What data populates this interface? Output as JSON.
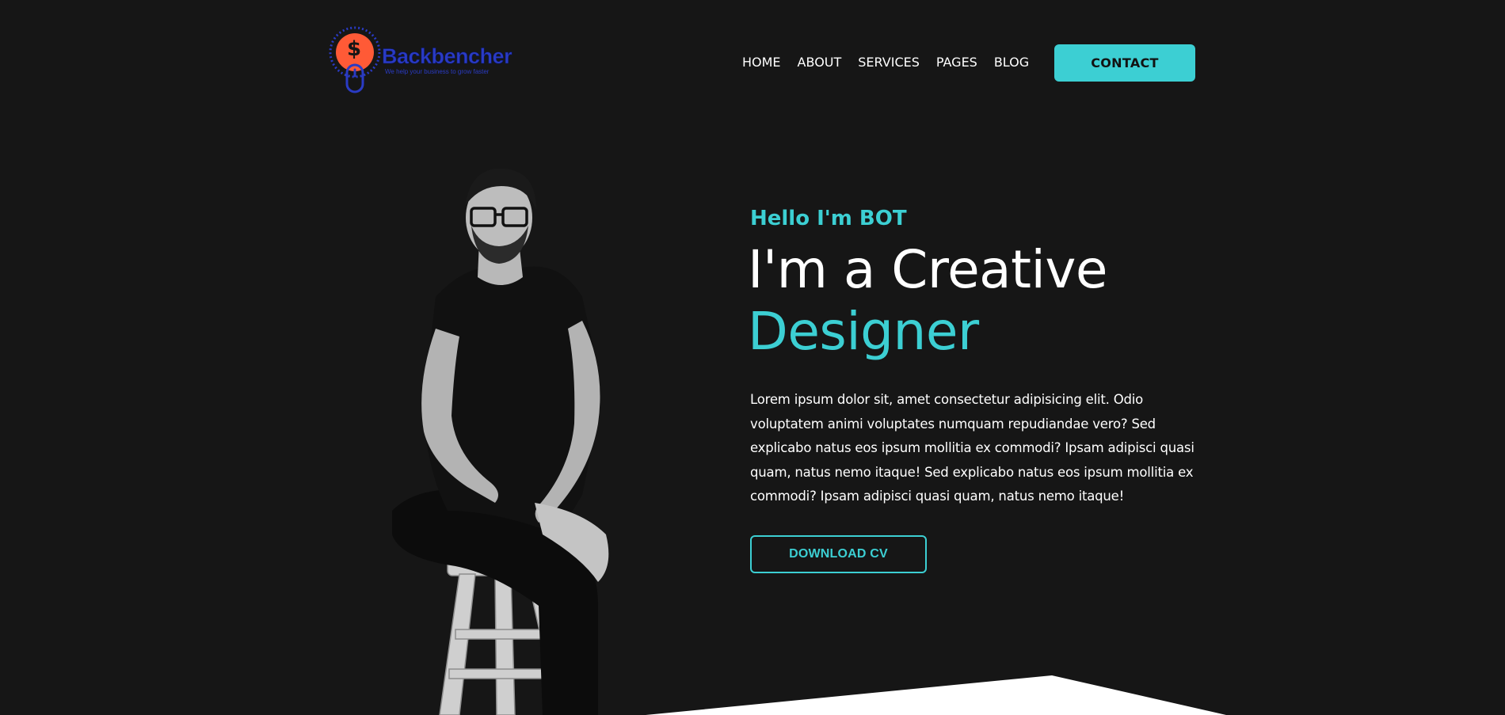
{
  "brand": {
    "name": "Backbencher",
    "tagline": "We help your business to grow faster",
    "dollar_symbol": "$",
    "colors": {
      "mark_orange": "#ff5a36",
      "mark_blue": "#2a3bc4"
    }
  },
  "nav": {
    "items": [
      {
        "label": "HOME"
      },
      {
        "label": "ABOUT"
      },
      {
        "label": "SERVICES"
      },
      {
        "label": "PAGES"
      },
      {
        "label": "BLOG"
      }
    ],
    "contact_label": "CONTACT"
  },
  "hero": {
    "greeting": "Hello I'm BOT",
    "headline_line1": "I'm a Creative",
    "headline_line2": "Designer",
    "description": "Lorem ipsum dolor sit, amet consectetur adipisicing elit. Odio voluptatem animi voluptates numquam repudiandae vero? Sed explicabo natus eos ipsum mollitia ex commodi? Ipsam adipisci quasi quam, natus nemo itaque! Sed explicabo natus eos ipsum mollitia ex commodi? Ipsam adipisci quasi quam, natus nemo itaque!",
    "cv_button_label": "DOWNLOAD CV"
  },
  "theme": {
    "background": "#161616",
    "accent": "#3ccfd3",
    "text": "#ffffff"
  }
}
